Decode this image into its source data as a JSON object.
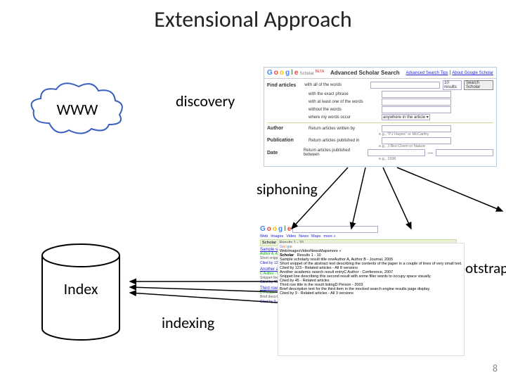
{
  "title": "Extensional Approach",
  "cloud_label": "WWW",
  "cylinder_label": "Index",
  "labels": {
    "discovery": "discovery",
    "siphoning": "siphoning",
    "indexing": "indexing",
    "bootstrap": "bootstrap"
  },
  "page_number": "8",
  "scholar_form": {
    "title": "Advanced Scholar Search",
    "tips_link": "Advanced Search Tips",
    "about_link": "About Google Scholar",
    "find_articles": "Find articles",
    "rows": {
      "all": "with all of the words",
      "phrase": "with the exact phrase",
      "least": "with at least one of the words",
      "without": "without the words",
      "where": "where my words occur"
    },
    "results_count": "10 results",
    "search_btn": "Search Scholar",
    "anywhere": "anywhere in the article",
    "author_label": "Author",
    "author_sub": "Return articles written by",
    "author_hint": "e.g., \"PJ Hayes\" or McCarthy",
    "pub_label": "Publication",
    "pub_sub": "Return articles published in",
    "pub_hint": "e.g., J Biol Chem or Nature",
    "date_label": "Date",
    "date_sub": "Return articles published between",
    "date_hint": "e.g., 1996"
  },
  "results": {
    "tabs": [
      "Web",
      "Images",
      "Video",
      "News",
      "Maps",
      "more »"
    ],
    "scholar_line": "Scholar",
    "bar": "Results 1 - 10",
    "items": [
      {
        "title": "Sample scholarly result title one",
        "meta": "Author A, Author B - Journal, 2005",
        "desc": "Short snippet of the abstract text describing the contents of the paper in a couple of lines of very small text.",
        "cited": "Cited by 123 - Related articles - All 8 versions"
      },
      {
        "title": "Another academic search result entry",
        "meta": "C Author - Conference, 2007",
        "desc": "Snippet line describing this second result with some filler words to occupy space visually.",
        "cited": "Cited by 45 - Related articles"
      },
      {
        "title": "Third row title in the result listing",
        "meta": "D Person - 2003",
        "desc": "Brief description text for the third item in the mocked search engine results page display.",
        "cited": "Cited by 9 - Related articles - All 3 versions"
      }
    ]
  }
}
